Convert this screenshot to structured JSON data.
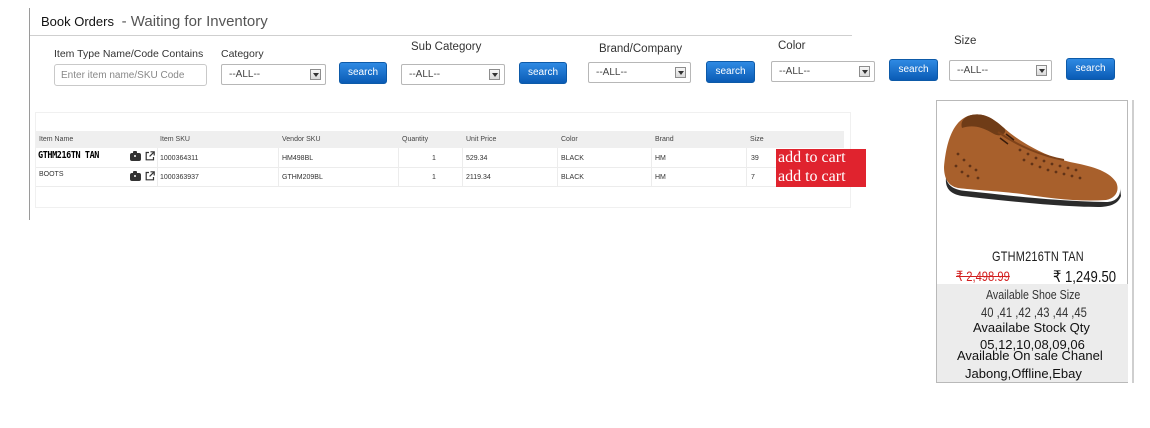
{
  "page": {
    "title": "Book Orders",
    "subtitle": "- Waiting for Inventory"
  },
  "filters": {
    "item_type": {
      "label": "Item Type Name/Code Contains",
      "placeholder": "Enter item name/SKU Code",
      "value": ""
    },
    "category": {
      "label": "Category",
      "selected": "--ALL--"
    },
    "sub_category": {
      "label": "Sub Category",
      "selected": "--ALL--"
    },
    "brand": {
      "label": "Brand/Company",
      "selected": "--ALL--"
    },
    "color": {
      "label": "Color",
      "selected": "--ALL--"
    },
    "size": {
      "label": "Size",
      "selected": "--ALL--"
    },
    "search_label": "search"
  },
  "table": {
    "headers": [
      "Item Name",
      "Item SKU",
      "Vendor SKU",
      "Quantity",
      "Unit Price",
      "Color",
      "Brand",
      "Size"
    ],
    "rows": [
      {
        "name": "GTHM216TN TAN",
        "sku": "1000364311",
        "vendor_sku": "HM498BL",
        "quantity": "1",
        "unit_price": "529.34",
        "color": "BLACK",
        "brand": "HM",
        "size": "39",
        "action": "add to cart"
      },
      {
        "name": "BOOTS",
        "sku": "1000363937",
        "vendor_sku": "GTHM209BL",
        "quantity": "1",
        "unit_price": "2119.34",
        "color": "BLACK",
        "brand": "HM",
        "size": "7",
        "action": "add to cart"
      }
    ],
    "icons": [
      "camera-icon",
      "external-link-icon"
    ]
  },
  "product_card": {
    "name": "GTHM216TN TAN",
    "old_price": "₹ 2,498.99",
    "new_price": "₹ 1,249.50",
    "size_label": "Available Shoe Size",
    "sizes": "40 ,41 ,42 ,43 ,44 ,45",
    "stock_label": "Avaailabe Stock Qty",
    "stock": "05,12,10,08,09,06",
    "channel_label": "Available On sale Chanel",
    "channels": "Jabong,Offline,Ebay",
    "image": "brown perforated leather shoe"
  },
  "colors": {
    "search_button": "#0a5bb5",
    "add_to_cart": "#e0232e",
    "old_price": "#d21f1f"
  }
}
